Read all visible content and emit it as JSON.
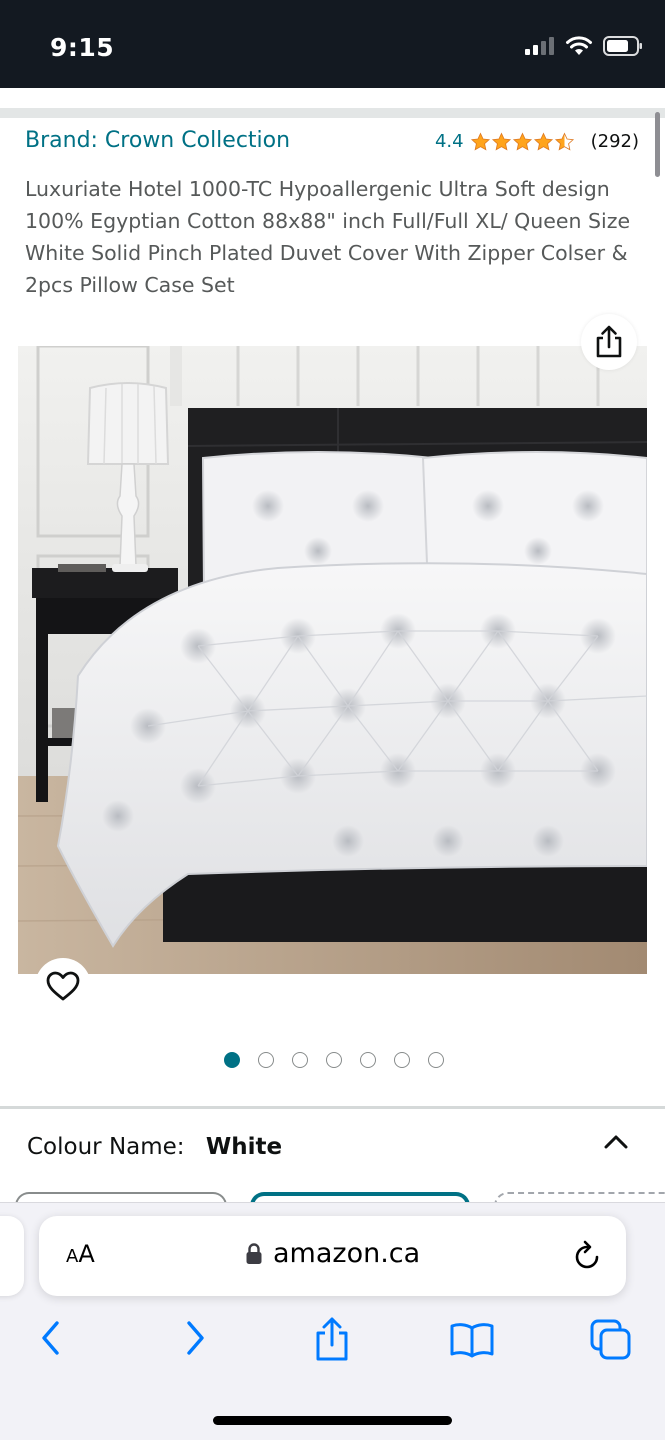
{
  "status_bar": {
    "time": "9:15"
  },
  "product": {
    "brand": "Brand: Crown Collection",
    "rating": "4.4",
    "rating_stars": 4.4,
    "review_count": "(292)",
    "title": "Luxuriate Hotel 1000-TC Hypoallergenic Ultra Soft design 100% Egyptian Cotton 88x88\" inch Full/Full XL/ Queen Size White Solid Pinch Plated Duvet Cover With Zipper Colser & 2pcs Pillow Case Set",
    "image_alt": "White pinch pleated duvet cover set on a bed",
    "image_count": 7,
    "active_image_index": 0
  },
  "variation": {
    "label": "Colour Name:",
    "selected": "White"
  },
  "browser": {
    "text_size_label_small": "A",
    "text_size_label_large": "A",
    "url": "amazon.ca"
  },
  "icons": {
    "share": "share-icon",
    "wishlist": "heart-icon",
    "collapse": "chevron-up-icon",
    "lock": "lock-icon",
    "reload": "reload-icon",
    "back": "chevron-left-icon",
    "forward": "chevron-right-icon",
    "browser_share": "share-icon",
    "bookmarks": "book-icon",
    "tabs": "tabs-icon"
  },
  "colors": {
    "link": "#007185",
    "star": "#ffa41c",
    "browser_blue": "#007aff",
    "status_bar_bg": "#131921"
  }
}
